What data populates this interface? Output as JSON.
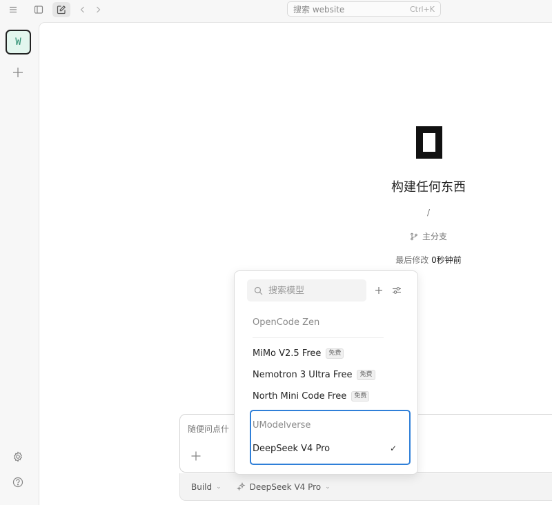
{
  "topbar": {
    "search_placeholder": "搜索 website",
    "search_shortcut": "Ctrl+K"
  },
  "rail": {
    "workspace_initial": "W"
  },
  "hero": {
    "title": "构建任何东西",
    "path": "/",
    "branch": "主分支",
    "modified_label": "最后修改",
    "modified_value": "0秒钟前"
  },
  "composer": {
    "placeholder": "随便问点什"
  },
  "bottom_bar": {
    "mode": "Build",
    "model": "DeepSeek V4 Pro"
  },
  "model_menu": {
    "search_placeholder": "搜索模型",
    "free_badge": "免费",
    "groups": [
      {
        "name": "OpenCode Zen",
        "models": [
          {
            "name": "MiMo V2.5 Free",
            "free": true
          },
          {
            "name": "Nemotron 3 Ultra Free",
            "free": true
          },
          {
            "name": "North Mini Code Free",
            "free": true
          }
        ]
      },
      {
        "name": "UModelverse",
        "models": [
          {
            "name": "DeepSeek V4 Pro",
            "free": false,
            "selected": true
          }
        ]
      }
    ],
    "check_mark": "✓"
  },
  "icons": {
    "menu": "hamburger-icon",
    "sidebar": "sidebar-toggle-icon",
    "compose": "edit-icon",
    "back": "chevron-left-icon",
    "forward": "chevron-right-icon",
    "add_workspace": "plus-icon",
    "settings": "gear-icon",
    "help": "help-icon",
    "branch": "branch-icon",
    "model": "sparkle-icon"
  },
  "colors": {
    "accent": "#2f7fd8",
    "workspace_tile_bg": "#e3f6ee",
    "workspace_tile_text": "#2f8f72"
  }
}
